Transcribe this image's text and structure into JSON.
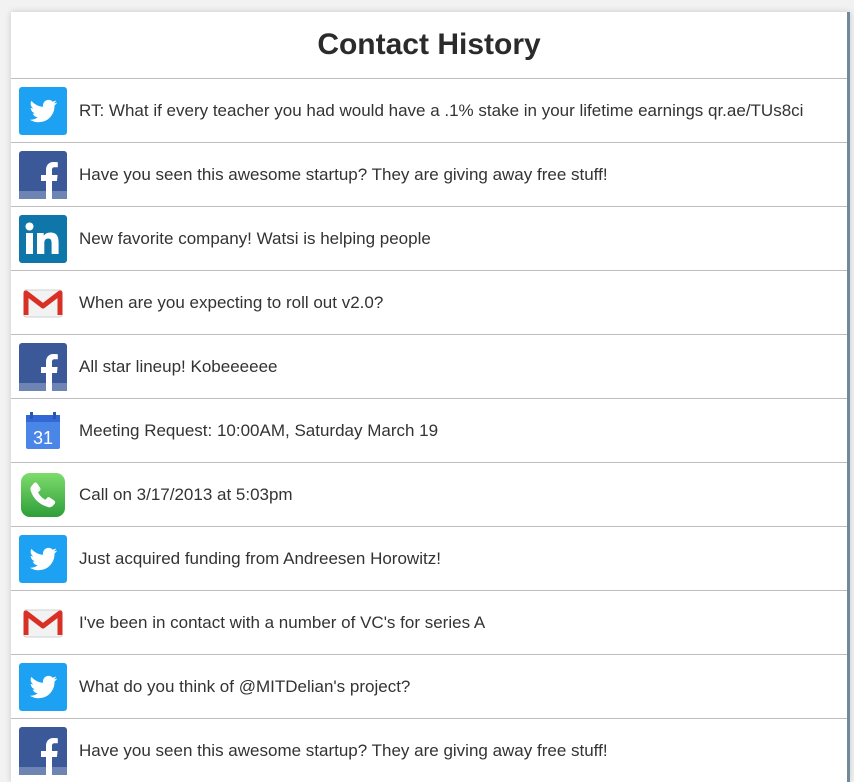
{
  "header": {
    "title": "Contact History"
  },
  "colors": {
    "twitter": "#1DA1F2",
    "facebook": "#3B5998",
    "linkedin": "#0E76A8",
    "gmail_red": "#D93025",
    "calendar_blue": "#4A86E8",
    "phone_green": "#3BB54A"
  },
  "history": [
    {
      "icon": "twitter-icon",
      "text": "RT: What if every teacher you had would have a .1% stake in your lifetime earnings qr.ae/TUs8ci"
    },
    {
      "icon": "facebook-icon",
      "text": "Have you seen this awesome startup? They are giving away free stuff!"
    },
    {
      "icon": "linkedin-icon",
      "text": "New favorite company! Watsi is helping people"
    },
    {
      "icon": "gmail-icon",
      "text": "When are you expecting to roll out v2.0?"
    },
    {
      "icon": "facebook-icon",
      "text": "All star lineup! Kobeeeeee"
    },
    {
      "icon": "calendar-icon",
      "text": "Meeting Request: 10:00AM, Saturday March 19"
    },
    {
      "icon": "phone-icon",
      "text": "Call on 3/17/2013 at 5:03pm"
    },
    {
      "icon": "twitter-icon",
      "text": "Just acquired funding from Andreesen Horowitz!"
    },
    {
      "icon": "gmail-icon",
      "text": "I've been in contact with a number of VC's for series A"
    },
    {
      "icon": "twitter-icon",
      "text": "What do you think of @MITDelian's project?"
    },
    {
      "icon": "facebook-icon",
      "text": "Have you seen this awesome startup? They are giving away free stuff!"
    }
  ],
  "calendar_icon_day": "31"
}
